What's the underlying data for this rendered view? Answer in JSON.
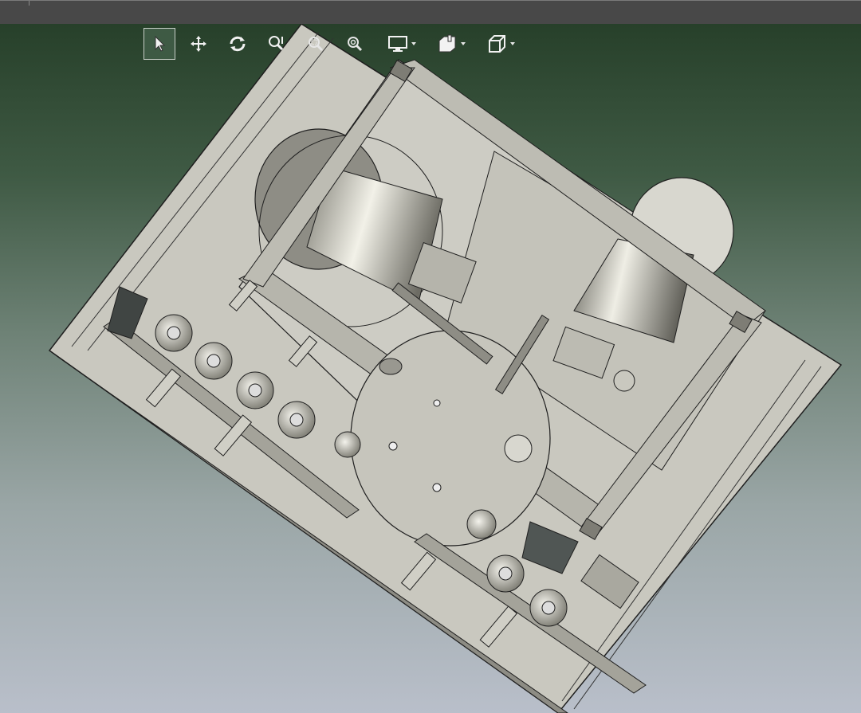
{
  "window": {
    "title": ""
  },
  "toolbar": {
    "tools": [
      {
        "name": "select",
        "icon": "cursor-arrow-icon",
        "active": true
      },
      {
        "name": "pan",
        "icon": "move-arrows-icon",
        "active": false
      },
      {
        "name": "rotate",
        "icon": "rotate-icon",
        "active": false
      },
      {
        "name": "zoom-dynamic",
        "icon": "zoom-dynamic-icon",
        "active": false
      },
      {
        "name": "zoom-window",
        "icon": "zoom-window-icon",
        "active": false
      },
      {
        "name": "zoom-fit",
        "icon": "zoom-fit-icon",
        "active": false
      },
      {
        "name": "display-mode",
        "icon": "monitor-icon",
        "dropdown": true
      },
      {
        "name": "section-view",
        "icon": "section-view-icon",
        "dropdown": true
      },
      {
        "name": "view-orientation",
        "icon": "cube-view-icon",
        "dropdown": true
      }
    ]
  },
  "viewport": {
    "background_top": "#27402a",
    "background_bottom": "#b9bfca",
    "model_color": "#c9c8bf",
    "model_edge_color": "#1f1f1f"
  }
}
